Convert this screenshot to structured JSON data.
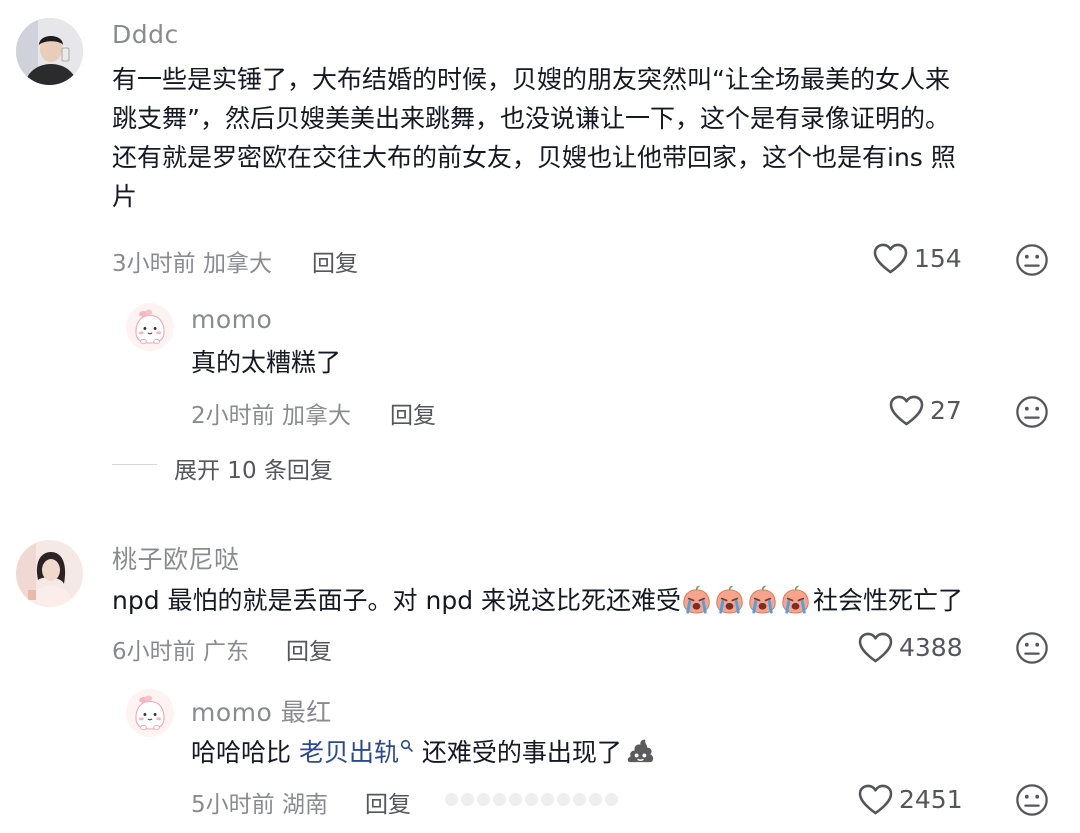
{
  "comments": [
    {
      "username": "Dddc",
      "text_lines": [
        "有一些是实锤了，大布结婚的时候，贝嫂的朋友突然叫“让全场最美的女人来",
        "跳支舞”，然后贝嫂美美出来跳舞，也没说谦让一下，这个是有录像证明的。",
        "还有就是罗密欧在交往大布的前女友，贝嫂也让他带回家，这个也是有ins 照",
        "片"
      ],
      "time": "3小时前",
      "location": "加拿大",
      "reply_label": "回复",
      "likes": "154",
      "replies": [
        {
          "username": "momo",
          "text": "真的太糟糕了",
          "time": "2小时前",
          "location": "加拿大",
          "reply_label": "回复",
          "likes": "27"
        }
      ],
      "expand_label": "展开 10 条回复"
    },
    {
      "username": "桃子欧尼哒",
      "text_before_emoji": "npd 最怕的就是丢面子。对 npd 来说这比死还难受",
      "emoji_count": 4,
      "emoji_name": "crying-emoji",
      "text_after_emoji": "社会性死亡了",
      "time": "6小时前",
      "location": "广东",
      "reply_label": "回复",
      "likes": "4388",
      "replies": [
        {
          "username": "momo 最红",
          "text_before_link": "哈哈哈比 ",
          "link_text": "老贝出轨",
          "link_icon": "search-icon",
          "text_after_link": " 还难受的事出现了",
          "trailing_emoji": "poop-emoji",
          "time": "5小时前",
          "location": "湖南",
          "reply_label": "回复",
          "likes": "2451"
        }
      ]
    }
  ],
  "colors": {
    "username": "#8a8b91",
    "text": "#161823",
    "meta": "#8a8b91",
    "link": "#2c4a8d"
  }
}
